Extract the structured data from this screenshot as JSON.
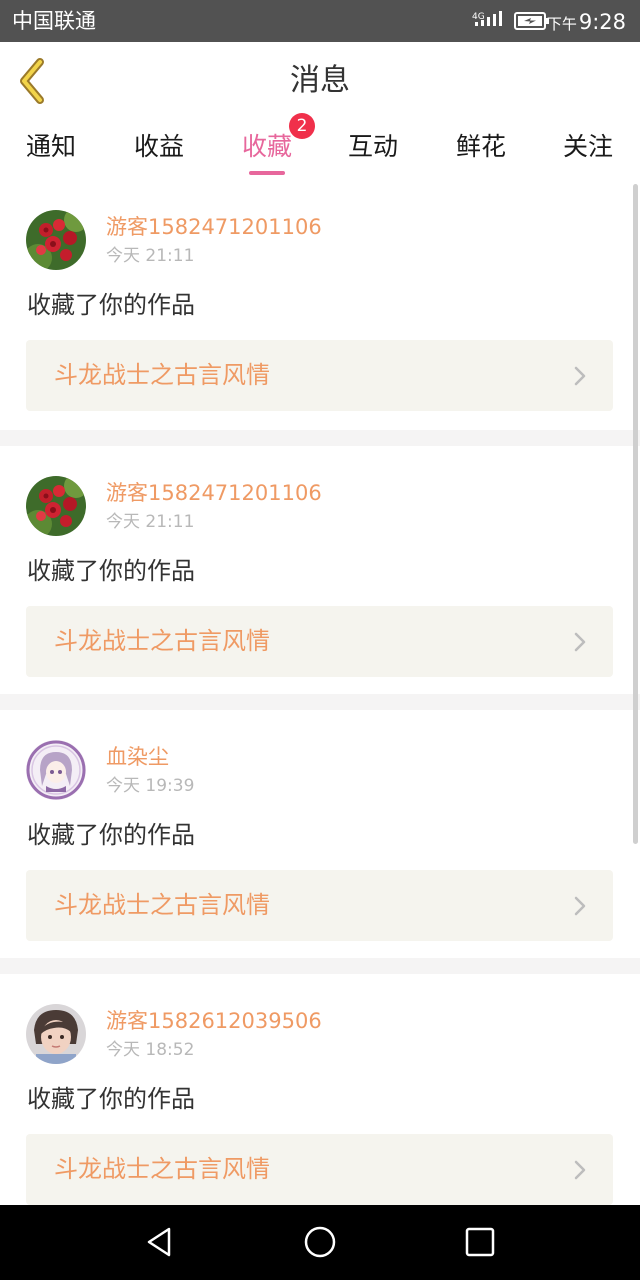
{
  "status_bar": {
    "carrier": "中国联通",
    "network": "4G",
    "time_prefix": "下午",
    "time": "9:28"
  },
  "header": {
    "title": "消息",
    "back_icon": "back-chevron-icon"
  },
  "tabs": [
    {
      "label": "通知",
      "active": false
    },
    {
      "label": "收益",
      "active": false
    },
    {
      "label": "收藏",
      "active": true,
      "badge": "2"
    },
    {
      "label": "互动",
      "active": false
    },
    {
      "label": "鲜花",
      "active": false
    },
    {
      "label": "关注",
      "active": false
    }
  ],
  "messages": [
    {
      "user": "游客1582471201106",
      "time": "今天 21:11",
      "action": "收藏了你的作品",
      "work": "斗龙战士之古言风情",
      "avatar": "red-roses"
    },
    {
      "user": "游客1582471201106",
      "time": "今天 21:11",
      "action": "收藏了你的作品",
      "work": "斗龙战士之古言风情",
      "avatar": "red-roses"
    },
    {
      "user": "血染尘",
      "time": "今天 19:39",
      "action": "收藏了你的作品",
      "work": "斗龙战士之古言风情",
      "avatar": "anime-girl-purple"
    },
    {
      "user": "游客1582612039506",
      "time": "今天 18:52",
      "action": "收藏了你的作品",
      "work": "斗龙战士之古言风情",
      "avatar": "child-photo"
    }
  ],
  "colors": {
    "accent": "#e7679c",
    "username": "#ef9a64",
    "badge": "#f0304b",
    "status_bar": "#525252",
    "link_bg": "#f5f4ee"
  }
}
